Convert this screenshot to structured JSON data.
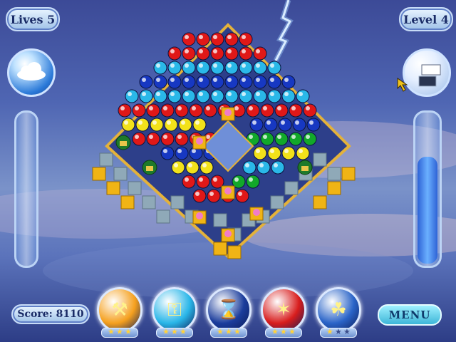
{
  "hud": {
    "lives_label": "Lives 5",
    "level_label": "Level 4",
    "score_label": "Score: 8110",
    "menu_label": "MENU"
  },
  "powerups": [
    {
      "name": "hammer",
      "icon": "hammer-icon",
      "color": "#f5a01e",
      "stars": 3
    },
    {
      "name": "key",
      "icon": "key-icon",
      "color": "#29b6e8",
      "stars": 3
    },
    {
      "name": "hourglass",
      "icon": "hourglass-icon",
      "color": "#1b3d9c",
      "stars": 3
    },
    {
      "name": "magic wand",
      "icon": "magic-wand-icon",
      "color": "#d81d1d",
      "stars": 3
    },
    {
      "name": "clover",
      "icon": "clover-icon",
      "color": "#2a64c8",
      "stars": 1
    }
  ],
  "colors": {
    "red": "#e01818",
    "green": "#12a82a",
    "blue": "#1738c2",
    "yellow": "#f2e21a",
    "cyan": "#2ab8e8",
    "tile": "#8fa9b8",
    "gold": "#f0b415"
  },
  "level_meter": 0.72
}
